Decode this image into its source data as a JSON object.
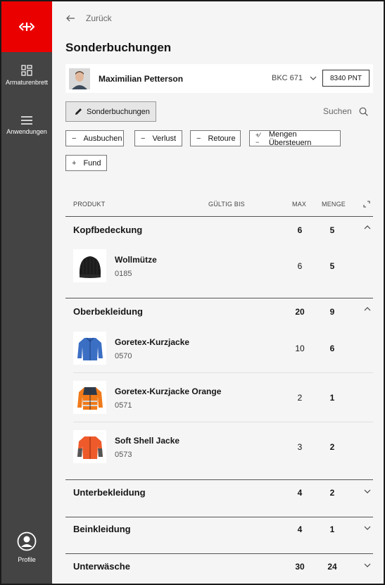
{
  "sidebar": {
    "items": [
      {
        "label": "Armaturenbrett",
        "icon": "dashboard-icon"
      },
      {
        "label": "Anwendungen",
        "icon": "menu-icon"
      },
      {
        "label": "Profile",
        "icon": "profile-icon"
      }
    ],
    "brand_color": "#eb0000"
  },
  "header": {
    "back_label": "Zurück",
    "title": "Sonderbuchungen"
  },
  "user": {
    "name": "Maximilian Petterson",
    "account": "BKC 671",
    "points": "8340 PNT"
  },
  "toolbar": {
    "sonderbuchungen_label": "Sonderbuchungen",
    "search_label": "Suchen",
    "actions": [
      {
        "symbol": "−",
        "label": "Ausbuchen"
      },
      {
        "symbol": "−",
        "label": "Verlust"
      },
      {
        "symbol": "−",
        "label": "Retoure"
      },
      {
        "symbol": "+⁄−",
        "label": "Mengen Übersteuern"
      },
      {
        "symbol": "+",
        "label": "Fund"
      }
    ]
  },
  "table": {
    "columns": {
      "produkt": "PRODUKT",
      "gueltig": "GÜLTIG BIS",
      "max": "MAX",
      "menge": "MENGE"
    },
    "groups": [
      {
        "name": "Kopfbedeckung",
        "max": "6",
        "menge": "5",
        "expanded": true
      },
      {
        "name": "Oberbekleidung",
        "max": "20",
        "menge": "9",
        "expanded": true
      },
      {
        "name": "Unterbekleidung",
        "max": "4",
        "menge": "2",
        "expanded": false
      },
      {
        "name": "Beinkleidung",
        "max": "4",
        "menge": "1",
        "expanded": false
      },
      {
        "name": "Unterwäsche",
        "max": "30",
        "menge": "24",
        "expanded": false
      }
    ],
    "items": [
      {
        "name": "Wollmütze",
        "code": "0185",
        "max": "6",
        "menge": "5",
        "icon": "beanie-image"
      },
      {
        "name": "Goretex-Kurzjacke",
        "code": "0570",
        "max": "10",
        "menge": "6",
        "icon": "blue-jacket-image"
      },
      {
        "name": "Goretex-Kurzjacke Orange",
        "code": "0571",
        "max": "2",
        "menge": "1",
        "icon": "orange-jacket-image"
      },
      {
        "name": "Soft Shell Jacke",
        "code": "0573",
        "max": "3",
        "menge": "2",
        "icon": "softshell-jacket-image"
      }
    ]
  }
}
